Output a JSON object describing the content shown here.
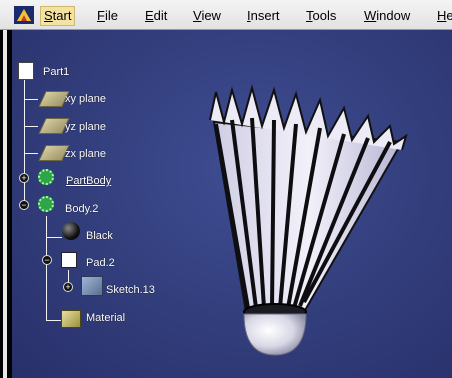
{
  "menubar": {
    "items": [
      "Start",
      "File",
      "Edit",
      "View",
      "Insert",
      "Tools",
      "Window",
      "He"
    ]
  },
  "tree": {
    "root": "Part1",
    "planes": [
      "xy plane",
      "yz plane",
      "zx plane"
    ],
    "partbody": "PartBody",
    "body": "Body.2",
    "black": "Black",
    "pad": "Pad.2",
    "sketch": "Sketch.13",
    "material": "Material"
  },
  "colors": {
    "background": "#34407f",
    "feathers": "#e7e5f3",
    "cork": "#d8d8e6"
  }
}
